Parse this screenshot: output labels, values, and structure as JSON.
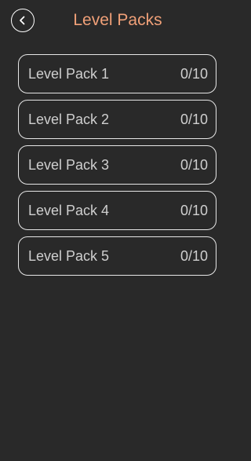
{
  "header": {
    "back_icon": "chevron-left-icon",
    "title": "Level Packs",
    "title_color": "#f0a078"
  },
  "packs": [
    {
      "name": "Level Pack 1",
      "progress": "0/10"
    },
    {
      "name": "Level Pack 2",
      "progress": "0/10"
    },
    {
      "name": "Level Pack 3",
      "progress": "0/10"
    },
    {
      "name": "Level Pack 4",
      "progress": "0/10"
    },
    {
      "name": "Level Pack 5",
      "progress": "0/10"
    }
  ],
  "colors": {
    "background": "#292929",
    "card_border": "#e6e6e6",
    "card_text": "#cfcfcf"
  }
}
